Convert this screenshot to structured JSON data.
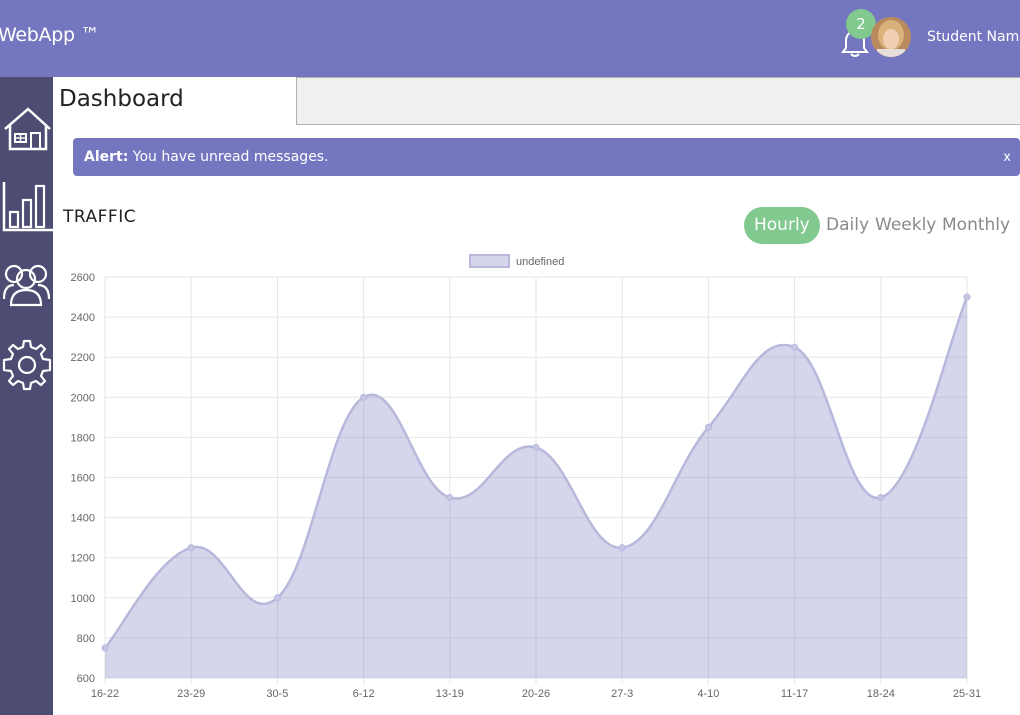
{
  "app": {
    "logo": "WebApp ™"
  },
  "header": {
    "notification_count": "2",
    "user_name": "Student Name"
  },
  "sidebar": {
    "items": [
      {
        "icon": "home-icon"
      },
      {
        "icon": "bar-chart-icon"
      },
      {
        "icon": "users-icon"
      },
      {
        "icon": "gear-icon"
      }
    ]
  },
  "page": {
    "title": "Dashboard"
  },
  "alert": {
    "label": "Alert:",
    "message": " You have unread messages.",
    "close": "x"
  },
  "traffic": {
    "title": "TRAFFIC",
    "tabs": [
      "Hourly",
      "Daily",
      "Weekly",
      "Monthly"
    ],
    "active_tab": "Hourly"
  },
  "colors": {
    "header": "#7477bf",
    "sidebar": "#4d4c72",
    "accent_green": "#81c98f",
    "chart_fill": "rgba(116,119,191,0.3)",
    "chart_line": "#b7b8dc"
  },
  "chart_data": {
    "type": "area",
    "legend": "undefined",
    "legend_position": "top",
    "categories": [
      "16-22",
      "23-29",
      "30-5",
      "6-12",
      "13-19",
      "20-26",
      "27-3",
      "4-10",
      "11-17",
      "18-24",
      "25-31"
    ],
    "values": [
      750,
      1250,
      1000,
      2000,
      1500,
      1750,
      1250,
      1850,
      2250,
      1500,
      2500
    ],
    "ylim": [
      600,
      2600
    ],
    "yticks": [
      600,
      800,
      1000,
      1200,
      1400,
      1600,
      1800,
      2000,
      2200,
      2400,
      2600
    ],
    "grid": true
  }
}
